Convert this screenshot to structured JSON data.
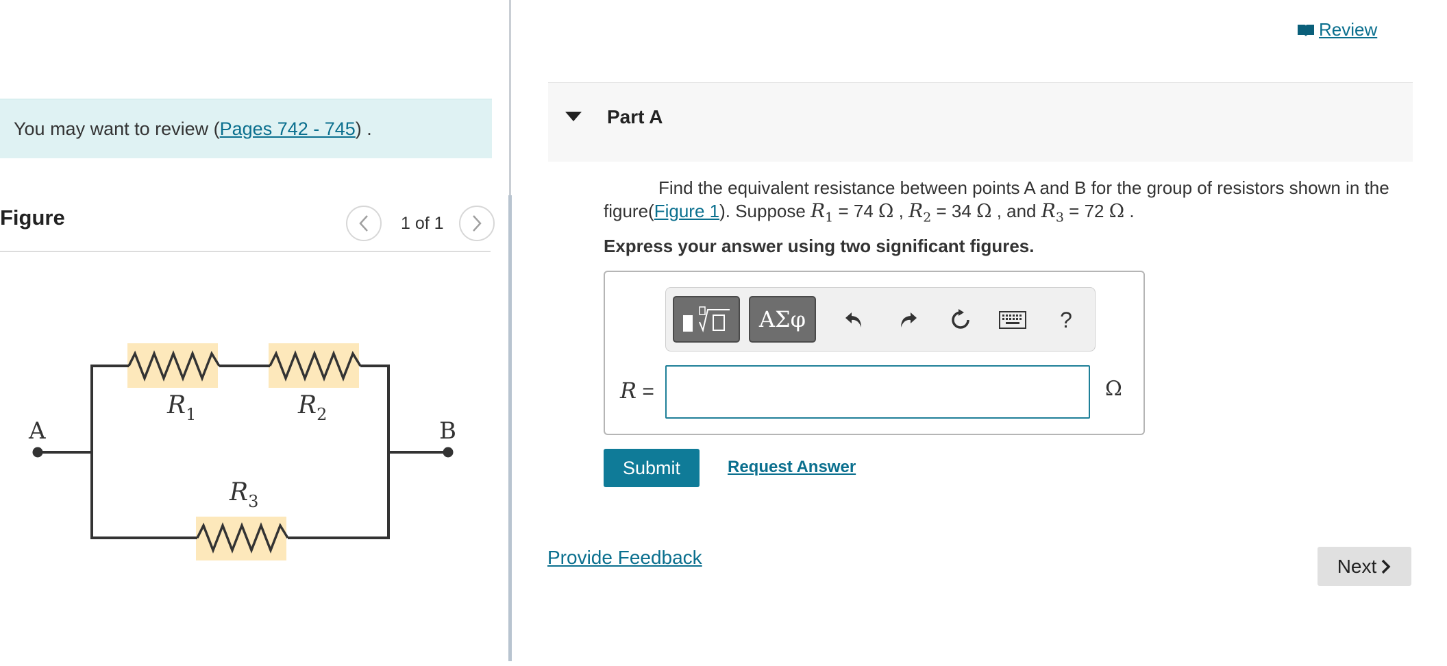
{
  "left": {
    "review_note_prefix": "You may want to review (",
    "review_note_link": "Pages 742 - 745",
    "review_note_suffix": ") .",
    "figure_heading": "Figure",
    "figure_count": "1 of 1",
    "prev_glyph": "<",
    "next_glyph": ">"
  },
  "circuit": {
    "node_a": "A",
    "node_b": "B",
    "r1": "R",
    "r1_sub": "1",
    "r2": "R",
    "r2_sub": "2",
    "r3": "R",
    "r3_sub": "3",
    "resistor_highlight_color": "#fde8bb",
    "wire_color": "#333333"
  },
  "header": {
    "review_label": "Review",
    "review_icon": "book-icon"
  },
  "part": {
    "title": "Part A"
  },
  "problem": {
    "text1": "Find the equivalent resistance between points A and B for the group of resistors shown in the figure(",
    "figure_link": "Figure 1",
    "text2": "). Suppose ",
    "r1_sym": "R",
    "r1_sub": "1",
    "r1_val": " = 74 ",
    "unit": "Ω",
    "sep1": " , ",
    "r2_sym": "R",
    "r2_sub": "2",
    "r2_val": " = 34 ",
    "sep2": " , and ",
    "r3_sym": "R",
    "r3_sub": "3",
    "r3_val": " = 72 ",
    "end": " ."
  },
  "instruction": "Express your answer using two significant figures.",
  "answer": {
    "variable": "R",
    "equals": " =",
    "value": "",
    "unit": "Ω",
    "toolbar": {
      "symbols_label": "ΑΣφ",
      "help_label": "?",
      "icons": [
        "templates-icon",
        "greek-symbols-icon",
        "undo-icon",
        "redo-icon",
        "reset-icon",
        "keyboard-icon",
        "help-icon"
      ]
    }
  },
  "actions": {
    "submit": "Submit",
    "request_answer": "Request Answer",
    "provide_feedback": "Provide Feedback",
    "next": "Next"
  },
  "colors": {
    "accent": "#0f7b98",
    "link": "#0a6f8e",
    "note_bg": "#dff2f3",
    "next_bg": "#e0e0e0"
  }
}
